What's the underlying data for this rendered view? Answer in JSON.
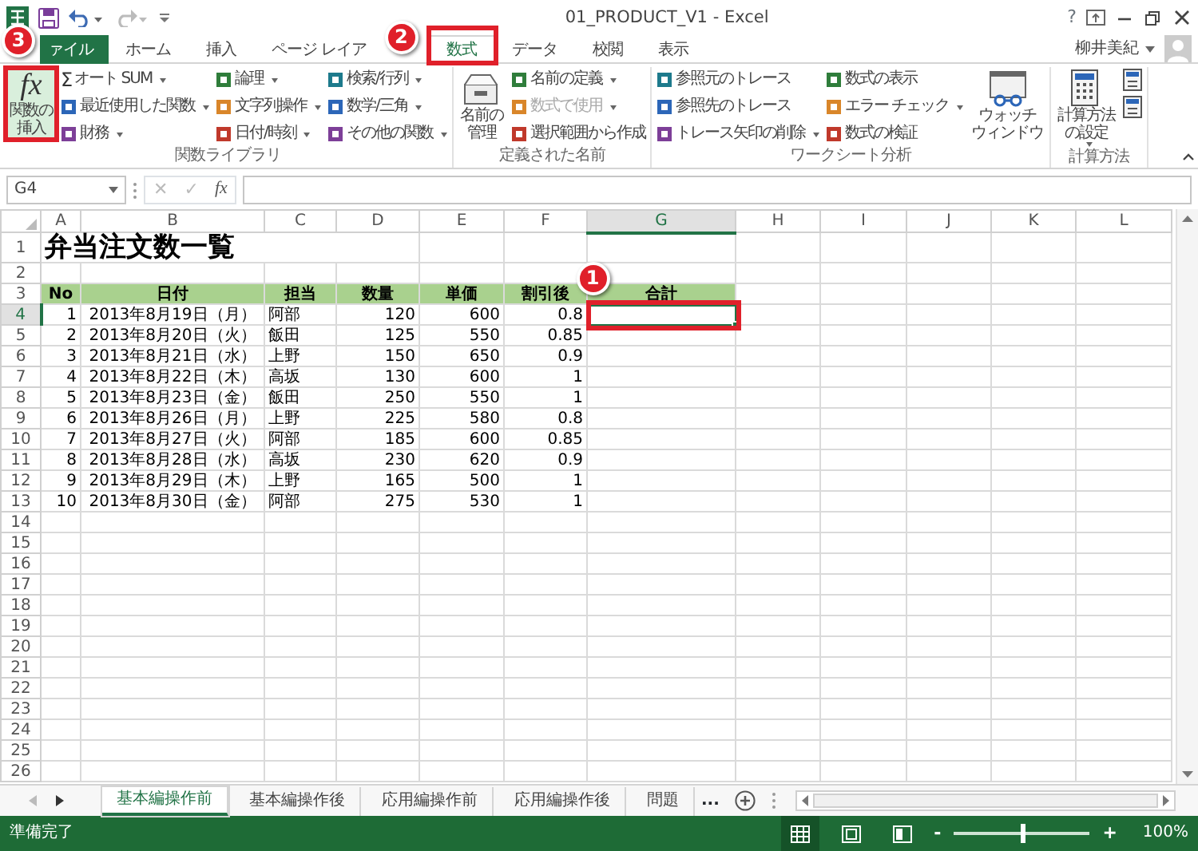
{
  "window": {
    "title": "01_PRODUCT_V1 - Excel",
    "help": "?",
    "user": "柳井美紀"
  },
  "ribbon_tabs": [
    {
      "label": "ァイル",
      "kind": "file",
      "selected": false
    },
    {
      "label": "ホーム",
      "kind": "tab",
      "selected": false
    },
    {
      "label": "挿入",
      "kind": "tab",
      "selected": false
    },
    {
      "label": "ページ レイア",
      "kind": "tab",
      "selected": false
    },
    {
      "label": "数式",
      "kind": "tab",
      "selected": true
    },
    {
      "label": "データ",
      "kind": "tab",
      "selected": false
    },
    {
      "label": "校閲",
      "kind": "tab",
      "selected": false
    },
    {
      "label": "表示",
      "kind": "tab",
      "selected": false
    }
  ],
  "ribbon_groups": [
    {
      "label": "関数ライブラリ",
      "items": [
        {
          "kind": "large",
          "icon_text": "fx",
          "lines": [
            "関数の",
            "挿入"
          ],
          "dropdown": false,
          "highlighted": true
        },
        {
          "kind": "stack",
          "items": [
            {
              "kind": "small",
              "icon_text": "Σ",
              "label": "オート SUM",
              "dropdown": true,
              "disabled": false
            },
            {
              "kind": "small",
              "label": "最近使用した関数",
              "dropdown": true,
              "disabled": false
            },
            {
              "kind": "small",
              "label": "財務",
              "dropdown": true,
              "disabled": false
            }
          ]
        },
        {
          "kind": "stack",
          "items": [
            {
              "kind": "small",
              "label": "論理",
              "dropdown": true,
              "disabled": false
            },
            {
              "kind": "small",
              "label": "文字列操作",
              "dropdown": true,
              "disabled": false
            },
            {
              "kind": "small",
              "label": "日付/時刻",
              "dropdown": true,
              "disabled": false
            }
          ]
        },
        {
          "kind": "stack",
          "items": [
            {
              "kind": "small",
              "label": "検索/行列",
              "dropdown": true,
              "disabled": false
            },
            {
              "kind": "small",
              "label": "数学/三角",
              "dropdown": true,
              "disabled": false
            },
            {
              "kind": "small",
              "label": "その他の関数",
              "dropdown": true,
              "disabled": false
            }
          ]
        }
      ]
    },
    {
      "label": "定義された名前",
      "items": [
        {
          "kind": "large",
          "lines": [
            "名前の",
            "管理"
          ],
          "dropdown": false,
          "highlighted": false
        },
        {
          "kind": "stack",
          "items": [
            {
              "kind": "small",
              "label": "名前の定義",
              "dropdown": true,
              "disabled": false
            },
            {
              "kind": "small",
              "label": "数式で使用",
              "dropdown": true,
              "disabled": true
            },
            {
              "kind": "small",
              "label": "選択範囲から作成",
              "dropdown": false,
              "disabled": false
            }
          ]
        }
      ]
    },
    {
      "label": "ワークシート分析",
      "items": [
        {
          "kind": "stack",
          "items": [
            {
              "kind": "small",
              "label": "参照元のトレース",
              "dropdown": false,
              "disabled": false
            },
            {
              "kind": "small",
              "label": "参照先のトレース",
              "dropdown": false,
              "disabled": false
            },
            {
              "kind": "small",
              "label": "トレース矢印の削除",
              "dropdown": true,
              "disabled": false
            }
          ]
        },
        {
          "kind": "stack",
          "items": [
            {
              "kind": "small",
              "label": "数式の表示",
              "dropdown": false,
              "disabled": false
            },
            {
              "kind": "small",
              "label": "エラー チェック",
              "dropdown": true,
              "disabled": false
            },
            {
              "kind": "small",
              "label": "数式の検証",
              "dropdown": false,
              "disabled": false
            }
          ]
        },
        {
          "kind": "large",
          "lines": [
            "ウォッチ",
            "ウィンドウ"
          ],
          "dropdown": false,
          "highlighted": false
        }
      ]
    },
    {
      "label": "計算方法",
      "items": [
        {
          "kind": "large",
          "lines": [
            "計算方法",
            "の設定"
          ],
          "dropdown": true,
          "highlighted": false
        },
        {
          "kind": "stack",
          "items": [
            {
              "kind": "icon_only"
            },
            {
              "kind": "icon_only"
            }
          ]
        }
      ]
    }
  ],
  "formula_bar": {
    "name_box": "G4",
    "cancel": "✕",
    "enter": "✓",
    "insert_function": "fx"
  },
  "sheet": {
    "columns": [
      {
        "label": "A",
        "selected": false
      },
      {
        "label": "B",
        "selected": false
      },
      {
        "label": "C",
        "selected": false
      },
      {
        "label": "D",
        "selected": false
      },
      {
        "label": "E",
        "selected": false
      },
      {
        "label": "F",
        "selected": false
      },
      {
        "label": "G",
        "selected": true
      },
      {
        "label": "H",
        "selected": false
      },
      {
        "label": "I",
        "selected": false
      },
      {
        "label": "J",
        "selected": false
      },
      {
        "label": "K",
        "selected": false
      },
      {
        "label": "L",
        "selected": false
      }
    ],
    "rows": [
      {
        "label": "1",
        "selected": false
      },
      {
        "label": "2",
        "selected": false
      },
      {
        "label": "3",
        "selected": false
      },
      {
        "label": "4",
        "selected": true
      },
      {
        "label": "5",
        "selected": false
      },
      {
        "label": "6",
        "selected": false
      },
      {
        "label": "7",
        "selected": false
      },
      {
        "label": "8",
        "selected": false
      },
      {
        "label": "9",
        "selected": false
      },
      {
        "label": "10",
        "selected": false
      },
      {
        "label": "11",
        "selected": false
      },
      {
        "label": "12",
        "selected": false
      },
      {
        "label": "13",
        "selected": false
      },
      {
        "label": "14",
        "selected": false
      },
      {
        "label": "15",
        "selected": false
      },
      {
        "label": "16",
        "selected": false
      },
      {
        "label": "17",
        "selected": false
      },
      {
        "label": "18",
        "selected": false
      },
      {
        "label": "19",
        "selected": false
      },
      {
        "label": "20",
        "selected": false
      },
      {
        "label": "21",
        "selected": false
      },
      {
        "label": "22",
        "selected": false
      },
      {
        "label": "23",
        "selected": false
      },
      {
        "label": "24",
        "selected": false
      },
      {
        "label": "25",
        "selected": false
      },
      {
        "label": "26",
        "selected": false
      }
    ],
    "title": "弁当注文数一覧",
    "header": [
      "No",
      "日付",
      "担当",
      "数量",
      "単価",
      "割引後",
      "合計"
    ],
    "records": [
      {
        "no": "1",
        "date": "2013年8月19日（月）",
        "staff": "阿部",
        "qty": "120",
        "price": "600",
        "discount": "0.8"
      },
      {
        "no": "2",
        "date": "2013年8月20日（火）",
        "staff": "飯田",
        "qty": "125",
        "price": "550",
        "discount": "0.85"
      },
      {
        "no": "3",
        "date": "2013年8月21日（水）",
        "staff": "上野",
        "qty": "150",
        "price": "650",
        "discount": "0.9"
      },
      {
        "no": "4",
        "date": "2013年8月22日（木）",
        "staff": "高坂",
        "qty": "130",
        "price": "600",
        "discount": "1"
      },
      {
        "no": "5",
        "date": "2013年8月23日（金）",
        "staff": "飯田",
        "qty": "250",
        "price": "550",
        "discount": "1"
      },
      {
        "no": "6",
        "date": "2013年8月26日（月）",
        "staff": "上野",
        "qty": "225",
        "price": "580",
        "discount": "0.8"
      },
      {
        "no": "7",
        "date": "2013年8月27日（火）",
        "staff": "阿部",
        "qty": "185",
        "price": "600",
        "discount": "0.85"
      },
      {
        "no": "8",
        "date": "2013年8月28日（水）",
        "staff": "高坂",
        "qty": "230",
        "price": "620",
        "discount": "0.9"
      },
      {
        "no": "9",
        "date": "2013年8月29日（木）",
        "staff": "上野",
        "qty": "165",
        "price": "500",
        "discount": "1"
      },
      {
        "no": "10",
        "date": "2013年8月30日（金）",
        "staff": "阿部",
        "qty": "275",
        "price": "530",
        "discount": "1"
      }
    ]
  },
  "sheet_tabs": [
    {
      "label": "基本編操作前",
      "selected": true
    },
    {
      "label": "基本編操作後",
      "selected": false
    },
    {
      "label": "応用編操作前",
      "selected": false
    },
    {
      "label": "応用編操作後",
      "selected": false
    },
    {
      "label": "問題",
      "selected": false
    }
  ],
  "sheet_tabs_more": "...",
  "status_bar": {
    "text": "準備完了",
    "views": [
      {
        "kind": "normal",
        "selected": true
      },
      {
        "kind": "page_layout",
        "selected": false
      },
      {
        "kind": "page_break",
        "selected": false
      }
    ],
    "zoom": {
      "minus": "-",
      "plus": "+",
      "level": 0.5,
      "reading": "100%"
    }
  },
  "callouts": [
    {
      "number": "1"
    },
    {
      "number": "2"
    },
    {
      "number": "3"
    }
  ]
}
